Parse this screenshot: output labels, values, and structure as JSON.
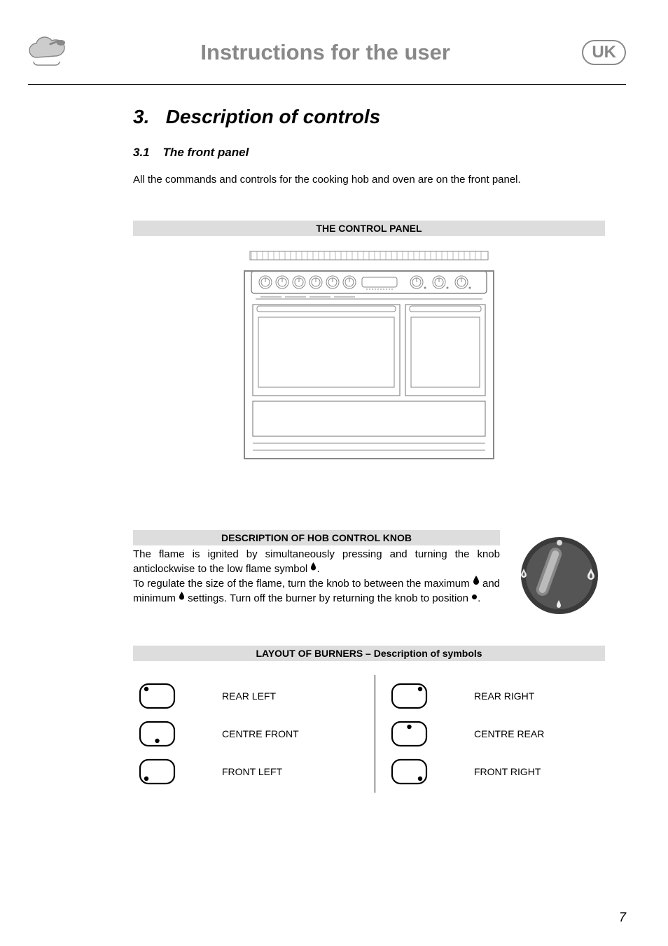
{
  "header": {
    "page_title": "Instructions for the user",
    "region_badge": "UK",
    "icon_name": "chef-cloud-spoon-icon"
  },
  "section": {
    "number": "3.",
    "title": "Description of controls",
    "subsection_number": "3.1",
    "subsection_title": "The front panel",
    "intro_text": "All the commands and controls for the cooking hob and oven are on the front panel."
  },
  "panel_heading": "THE CONTROL PANEL",
  "hob_knob": {
    "heading": "DESCRIPTION OF HOB CONTROL KNOB",
    "para_1_a": "The flame is ignited by simultaneously pressing and turning the knob anticlockwise to the low flame symbol ",
    "para_1_b": ".",
    "para_2_a": "To regulate the size of the flame, turn the knob to between the maximum ",
    "para_2_b": " and minimum ",
    "para_2_c": " settings. Turn off the burner by returning the knob to position ",
    "para_2_d": "."
  },
  "burners": {
    "heading": "LAYOUT OF BURNERS – Description of symbols",
    "items": [
      {
        "position": "rear-left",
        "label": "REAR LEFT",
        "dot": "tl"
      },
      {
        "position": "rear-right",
        "label": "REAR RIGHT",
        "dot": "tr"
      },
      {
        "position": "centre-front",
        "label": "CENTRE FRONT",
        "dot": "cb"
      },
      {
        "position": "centre-rear",
        "label": "CENTRE REAR",
        "dot": "ct"
      },
      {
        "position": "front-left",
        "label": "FRONT LEFT",
        "dot": "bl"
      },
      {
        "position": "front-right",
        "label": "FRONT RIGHT",
        "dot": "br"
      }
    ]
  },
  "page_number": "7"
}
